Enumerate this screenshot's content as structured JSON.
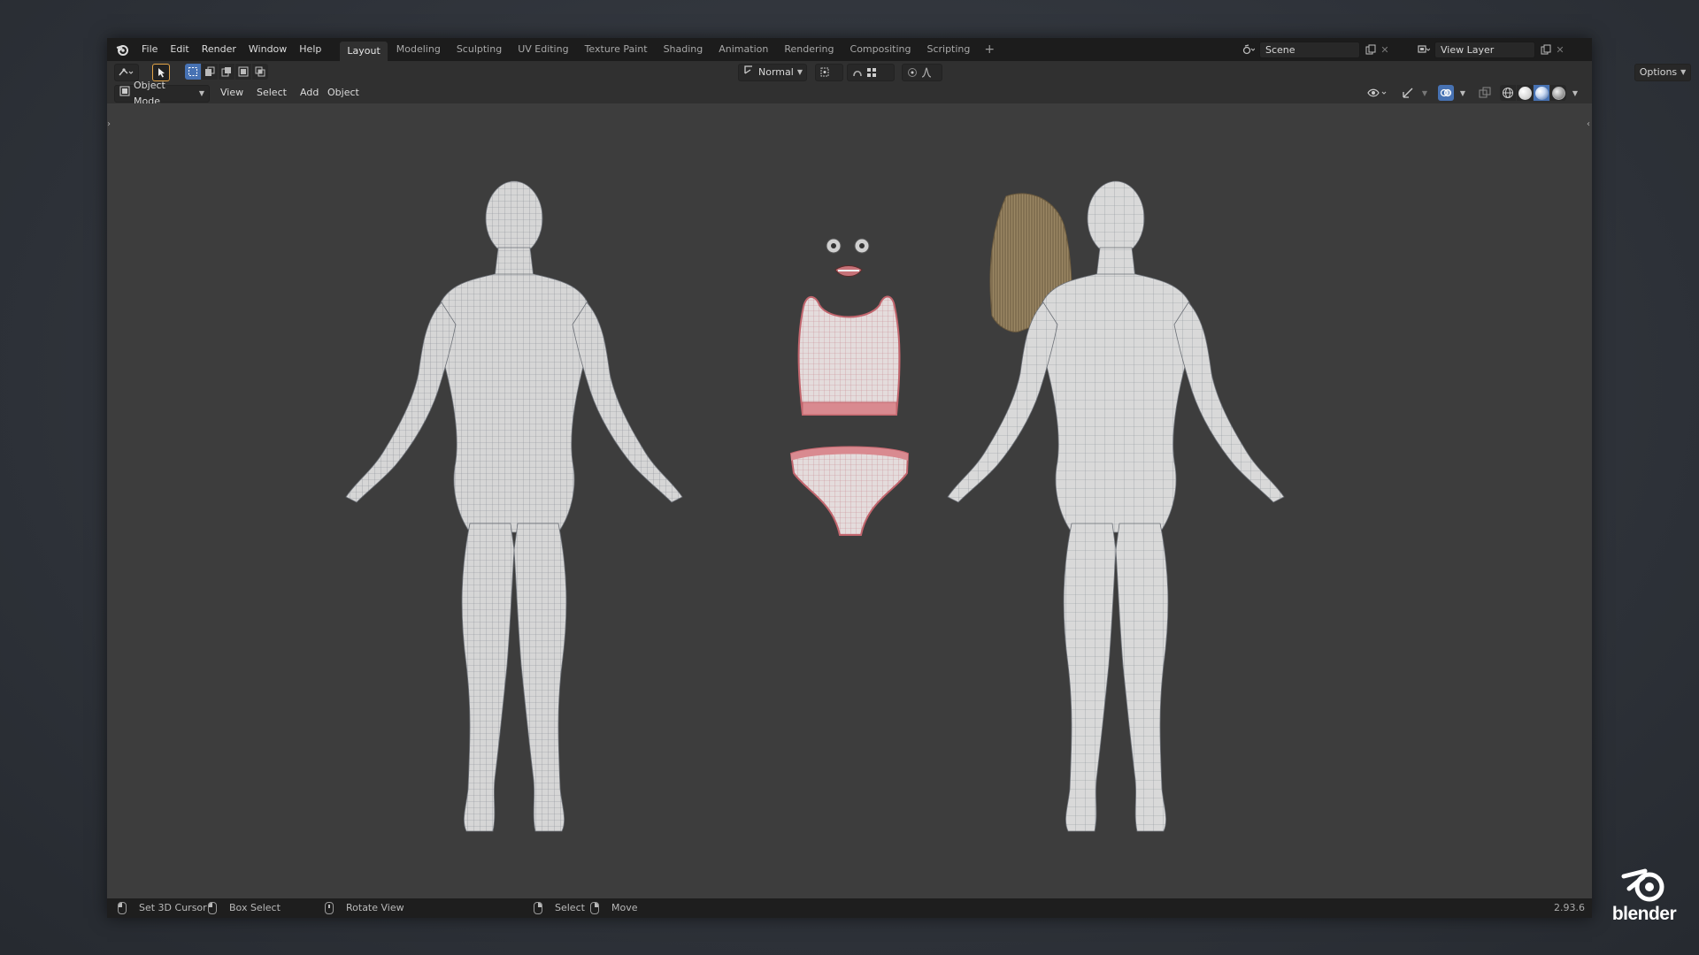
{
  "menu": [
    "File",
    "Edit",
    "Render",
    "Window",
    "Help"
  ],
  "workspaces": [
    "Layout",
    "Modeling",
    "Sculpting",
    "UV Editing",
    "Texture Paint",
    "Shading",
    "Animation",
    "Rendering",
    "Compositing",
    "Scripting"
  ],
  "active_workspace": "Layout",
  "scene": {
    "name": "Scene"
  },
  "view_layer": {
    "name": "View Layer"
  },
  "tool_header": {
    "orientation": "Normal",
    "options_label": "Options"
  },
  "viewport_header": {
    "mode": "Object Mode",
    "menus": [
      "View",
      "Select",
      "Add",
      "Object"
    ]
  },
  "status": {
    "set_cursor": "Set 3D Cursor",
    "box_select": "Box Select",
    "rotate_view": "Rotate View",
    "select": "Select",
    "move": "Move",
    "version": "2.93.6"
  },
  "brand": {
    "word": "blender"
  },
  "colors": {
    "accent": "#4772b3",
    "viewport_bg": "#3d3d3d",
    "mesh": "#cfcfcf",
    "cloth_edge": "#d9707a",
    "hair": "#8f7a58"
  },
  "icons": [
    "blender-logo-icon",
    "editor-type-icon",
    "select-tool-icon",
    "select-box-icon",
    "transform-orientation-icon",
    "pivot-icon",
    "snap-icon",
    "proportional-icon",
    "visibility-icon",
    "gizmo-icon",
    "overlay-icon",
    "xray-icon",
    "wireframe-shading-icon",
    "solid-shading-icon",
    "material-shading-icon",
    "rendered-shading-icon",
    "scene-icon",
    "view-layer-icon",
    "new-icon",
    "close-icon"
  ]
}
